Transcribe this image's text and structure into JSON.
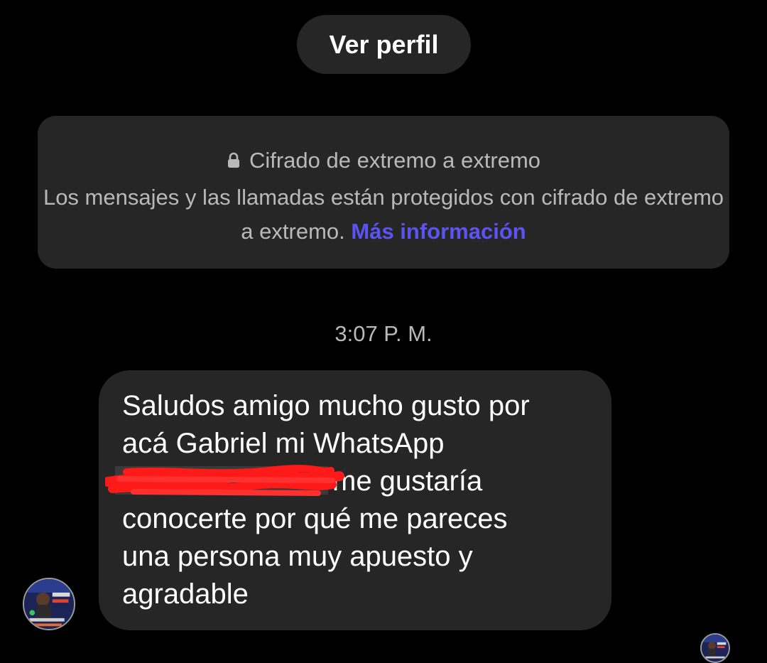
{
  "header": {
    "view_profile_label": "Ver perfil"
  },
  "encryption_notice": {
    "icon": "lock-icon",
    "title": "Cifrado de extremo a extremo",
    "body": "Los mensajes y las llamadas están protegidos con cifrado de extremo a extremo.",
    "link_label": "Más información",
    "link_color": "#5b54f0"
  },
  "conversation": {
    "timestamp": "3:07 P. M.",
    "message": {
      "lines": [
        "Saludos amigo mucho gusto por",
        "acá Gabriel mi WhatsApp",
        "me gustaría",
        "conocerte por qué me pareces",
        "una persona muy apuesto y",
        "agradable"
      ],
      "bubble_color": "#262626"
    },
    "sender_avatar": "profile-avatar",
    "seen_avatar": "read-receipt-avatar"
  },
  "colors": {
    "background": "#000000",
    "card": "#262626",
    "secondary_text": "#b9b9b9",
    "redaction": "#ff1a1a"
  }
}
